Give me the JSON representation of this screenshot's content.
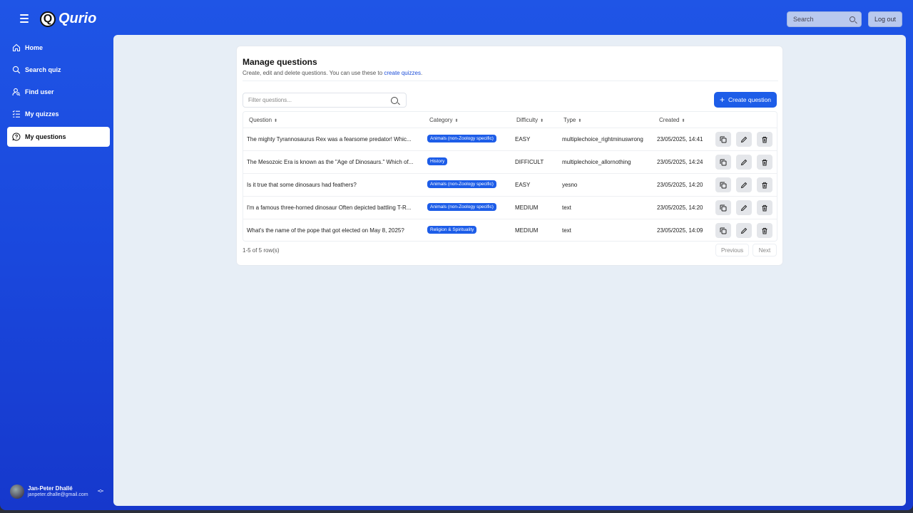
{
  "app": {
    "name": "Qurio",
    "logo_letter": "Q"
  },
  "topbar": {
    "search_placeholder": "Search",
    "logout_label": "Log out"
  },
  "sidebar": {
    "items": [
      {
        "label": "Home",
        "icon": "home-icon",
        "active": false
      },
      {
        "label": "Search quiz",
        "icon": "search-icon",
        "active": false
      },
      {
        "label": "Find user",
        "icon": "user-search-icon",
        "active": false
      },
      {
        "label": "My quizzes",
        "icon": "list-icon",
        "active": false
      },
      {
        "label": "My questions",
        "icon": "question-bubble-icon",
        "active": true
      }
    ],
    "user": {
      "name": "Jan-Peter Dhallé",
      "email": "janpeter.dhalle@gmail.com"
    }
  },
  "page": {
    "title": "Manage questions",
    "description": "Create, edit and delete questions. You can use these to ",
    "description_link": "create quizzes",
    "description_end": ".",
    "filter_placeholder": "Filter questions...",
    "create_button": "Create question"
  },
  "table": {
    "columns": [
      "Question",
      "Category",
      "Difficulty",
      "Type",
      "Created"
    ],
    "rows": [
      {
        "question": "The mighty Tyrannosaurus Rex was a fearsome predator! Whic...",
        "category": "Animals (non-Zoology specific)",
        "difficulty": "EASY",
        "type": "multiplechoice_rightminuswrong",
        "created": "23/05/2025, 14:41"
      },
      {
        "question": "The Mesozoic Era is known as the \"Age of Dinosaurs.\" Which of...",
        "category": "History",
        "difficulty": "DIFFICULT",
        "type": "multiplechoice_allornothing",
        "created": "23/05/2025, 14:24"
      },
      {
        "question": "Is it true that some dinosaurs had feathers?",
        "category": "Animals (non-Zoology specific)",
        "difficulty": "EASY",
        "type": "yesno",
        "created": "23/05/2025, 14:20"
      },
      {
        "question": "I'm a famous three-horned dinosaur Often depicted battling T-R...",
        "category": "Animals (non-Zoology specific)",
        "difficulty": "MEDIUM",
        "type": "text",
        "created": "23/05/2025, 14:20"
      },
      {
        "question": "What's the name of the pope that got elected on May 8, 2025?",
        "category": "Religion & Spirituality",
        "difficulty": "MEDIUM",
        "type": "text",
        "created": "23/05/2025, 14:09"
      }
    ],
    "actions": [
      "copy-icon",
      "pencil-icon",
      "trash-icon"
    ]
  },
  "pagination": {
    "info": "1-5 of 5 row(s)",
    "previous": "Previous",
    "next": "Next"
  },
  "colors": {
    "brand": "#1f55e6",
    "accent": "#1d5de8",
    "background": "#e7eef6"
  }
}
